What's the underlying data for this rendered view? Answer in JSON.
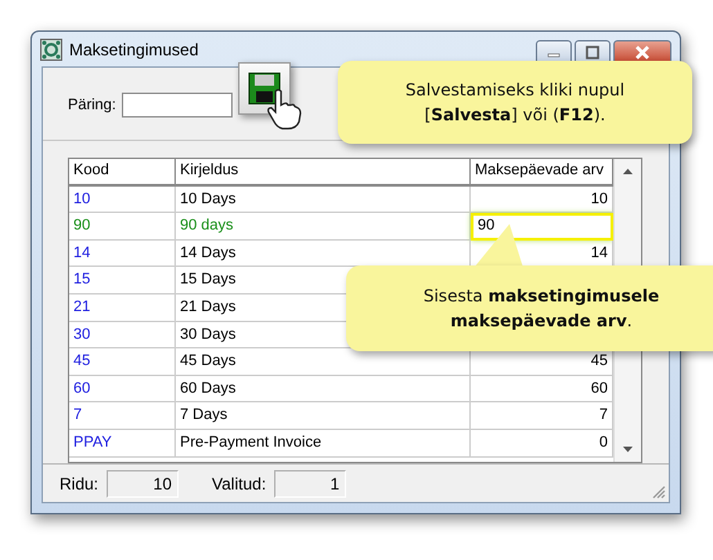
{
  "window": {
    "title": "Maksetingimused"
  },
  "query": {
    "label": "Päring:"
  },
  "table": {
    "columns": [
      "Kood",
      "Kirjeldus",
      "Maksepäevade arv"
    ],
    "rows": [
      {
        "code": "10",
        "description": "10 Days",
        "days": "10",
        "edited": false
      },
      {
        "code": "90",
        "description": "90 days",
        "days": "90",
        "edited": true
      },
      {
        "code": "14",
        "description": "14 Days",
        "days": "14",
        "edited": false
      },
      {
        "code": "15",
        "description": "15 Days",
        "edited": false
      },
      {
        "code": "21",
        "description": "21 Days",
        "edited": false
      },
      {
        "code": "30",
        "description": "30 Days",
        "edited": false
      },
      {
        "code": "45",
        "description": "45 Days",
        "days": "45",
        "edited": false
      },
      {
        "code": "60",
        "description": "60 Days",
        "days": "60",
        "edited": false
      },
      {
        "code": "7",
        "description": "7 Days",
        "days": "7",
        "edited": false
      },
      {
        "code": "PPAY",
        "description": "Pre-Payment Invoice",
        "days": "0",
        "edited": false
      }
    ]
  },
  "callouts": [
    {
      "kind": "save",
      "text": "Salvestamiseks kliki nupul [**Salvesta**] või (**F12**)."
    },
    {
      "kind": "input",
      "text": "Sisesta **maksetingimusele maksepäevade arv**."
    }
  ],
  "status_bar": {
    "rows_label": "Ridu:",
    "rows": "10",
    "selected_label": "Valitud:",
    "selected": "1"
  }
}
